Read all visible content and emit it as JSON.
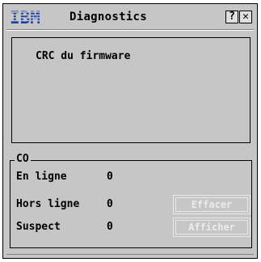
{
  "window": {
    "logo": "IBM",
    "title": "Diagnostics",
    "help_label": "?",
    "close_label": "✕"
  },
  "list": {
    "items": [
      "CRC du firmware"
    ]
  },
  "group": {
    "label": "CO",
    "rows": [
      {
        "label": "En ligne",
        "value": "0"
      },
      {
        "label": "Hors ligne",
        "value": "0"
      },
      {
        "label": "Suspect",
        "value": "0"
      }
    ]
  },
  "buttons": {
    "clear_label": "Effacer",
    "show_label": "Afficher",
    "enabled": false
  },
  "colors": {
    "window_bg": "#c6c6c6",
    "logo_blue": "#1f3fa0",
    "disabled_text": "#ececec"
  }
}
